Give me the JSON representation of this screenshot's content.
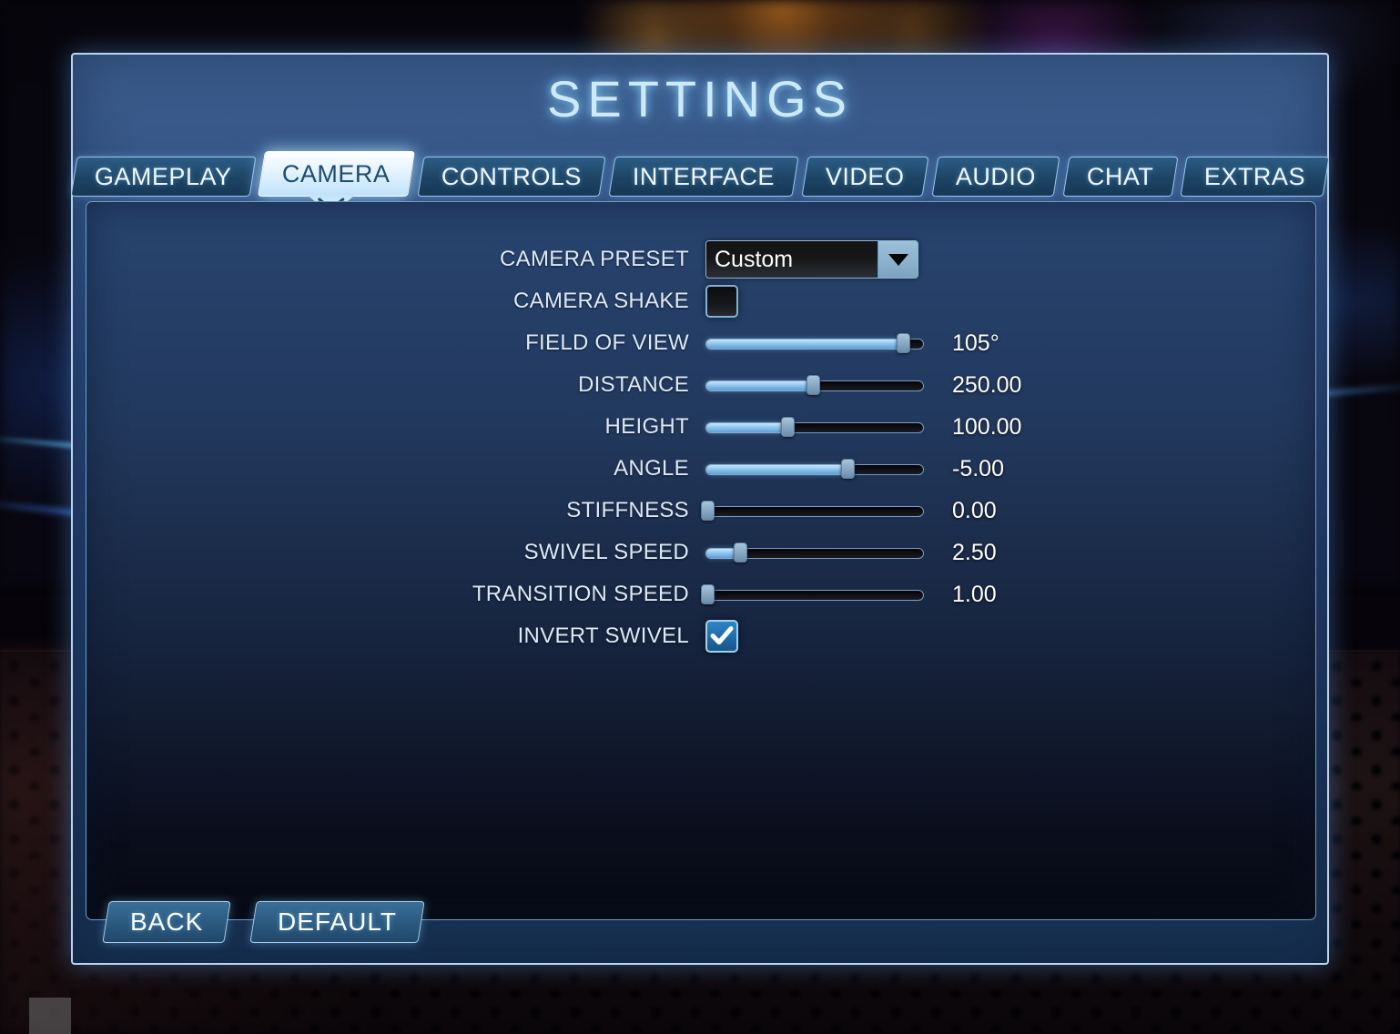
{
  "window": {
    "title": "SETTINGS"
  },
  "tabs": [
    {
      "label": "GAMEPLAY",
      "active": false
    },
    {
      "label": "CAMERA",
      "active": true
    },
    {
      "label": "CONTROLS",
      "active": false
    },
    {
      "label": "INTERFACE",
      "active": false
    },
    {
      "label": "VIDEO",
      "active": false
    },
    {
      "label": "AUDIO",
      "active": false
    },
    {
      "label": "CHAT",
      "active": false
    },
    {
      "label": "EXTRAS",
      "active": false
    }
  ],
  "settings": [
    {
      "label": "CAMERA PRESET",
      "type": "dropdown",
      "value": "Custom",
      "name": "camera-preset"
    },
    {
      "label": "CAMERA SHAKE",
      "type": "checkbox",
      "checked": false,
      "name": "camera-shake"
    },
    {
      "label": "FIELD OF VIEW",
      "type": "slider",
      "value": "105°",
      "percent": 92,
      "name": "field-of-view"
    },
    {
      "label": "DISTANCE",
      "type": "slider",
      "value": "250.00",
      "percent": 50,
      "name": "distance"
    },
    {
      "label": "HEIGHT",
      "type": "slider",
      "value": "100.00",
      "percent": 38,
      "name": "height"
    },
    {
      "label": "ANGLE",
      "type": "slider",
      "value": "-5.00",
      "percent": 66,
      "name": "angle"
    },
    {
      "label": "STIFFNESS",
      "type": "slider",
      "value": "0.00",
      "percent": 1,
      "name": "stiffness"
    },
    {
      "label": "SWIVEL SPEED",
      "type": "slider",
      "value": "2.50",
      "percent": 16,
      "name": "swivel-speed"
    },
    {
      "label": "TRANSITION SPEED",
      "type": "slider",
      "value": "1.00",
      "percent": 1,
      "name": "transition-speed"
    },
    {
      "label": "INVERT SWIVEL",
      "type": "checkbox",
      "checked": true,
      "name": "invert-swivel"
    }
  ],
  "footer": {
    "buttons": [
      {
        "label": "BACK",
        "name": "back"
      },
      {
        "label": "DEFAULT",
        "name": "default"
      }
    ]
  },
  "icons": {
    "dropdown_arrow": "chevron-down-icon",
    "check": "check-icon",
    "tab_pointer": "chevron-down-icon"
  },
  "colors": {
    "accent": "#8dc4ec",
    "window_border": "#b9d4ee",
    "title_glow": "#cdeafd",
    "active_tab_text": "#1b4c75"
  }
}
